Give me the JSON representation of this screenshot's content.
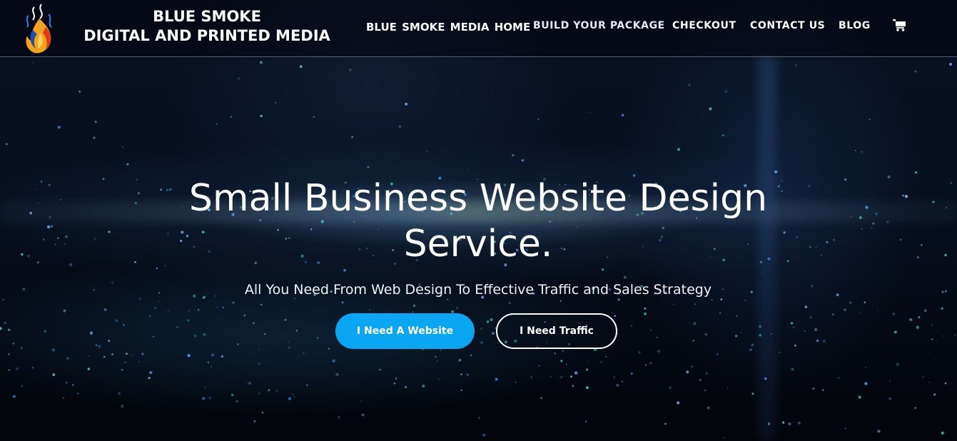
{
  "brand": {
    "line1": "BLUE SMOKE",
    "line2": "DIGITAL AND PRINTED MEDIA",
    "logo_icon": "flame-logo-icon"
  },
  "nav": {
    "items": [
      {
        "label": "BLUE  SMOKE  MEDIA  HOME"
      },
      {
        "label": "BUILD YOUR PACKAGE"
      },
      {
        "label": "CHECKOUT"
      },
      {
        "label": "CONTACT US"
      },
      {
        "label": "BLOG"
      }
    ],
    "cart_icon": "shopping-cart-icon"
  },
  "hero": {
    "title": "Small Business Website Design Service.",
    "subtitle": "All You Need From Web Design To Effective Traffic and Sales Strategy",
    "primary_button": "I Need A Website",
    "secondary_button": "I Need Traffic"
  },
  "colors": {
    "accent": "#0aa6f2",
    "background": "#05070f",
    "text": "#ffffff"
  }
}
